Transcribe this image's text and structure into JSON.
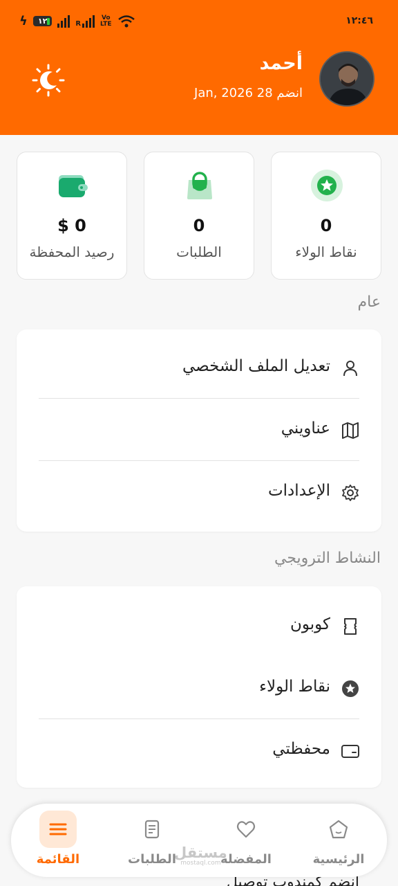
{
  "status_bar": {
    "time": "١٢:٤٦",
    "battery": "١٢",
    "network": "VoLTE"
  },
  "profile": {
    "name": "أحمد",
    "joined": "انضم 28 Jan, 2026"
  },
  "stats": [
    {
      "value": "0",
      "label": "نقاط الولاء",
      "icon": "star-badge-icon",
      "color": "#22b14c"
    },
    {
      "value": "0",
      "label": "الطلبات",
      "icon": "shopping-bag-icon",
      "color": "#22b14c"
    },
    {
      "value": "$ 0",
      "label": "رصيد المحفظة",
      "icon": "wallet-icon",
      "color": "#1aaa6e"
    }
  ],
  "sections": {
    "general": {
      "title": "عام",
      "items": [
        {
          "label": "تعديل الملف الشخصي",
          "icon": "user-icon"
        },
        {
          "label": "عناويني",
          "icon": "map-icon"
        },
        {
          "label": "الإعدادات",
          "icon": "gear-icon"
        }
      ]
    },
    "promo": {
      "title": "النشاط الترويجي",
      "items": [
        {
          "label": "كوبون",
          "icon": "coupon-icon"
        },
        {
          "label": "نقاط الولاء",
          "icon": "star-icon"
        },
        {
          "label": "محفظتي",
          "icon": "wallet-outline-icon"
        }
      ]
    },
    "partial_row": "انضم كمندوب توصيل"
  },
  "bottom_nav": [
    {
      "label": "الرئيسية",
      "icon": "home-icon",
      "active": false
    },
    {
      "label": "المفضلة",
      "icon": "heart-icon",
      "active": false
    },
    {
      "label": "الطلبات",
      "icon": "orders-icon",
      "active": false
    },
    {
      "label": "القائمة",
      "icon": "menu-icon",
      "active": true
    }
  ],
  "watermark": {
    "text": "مستقل",
    "sub": "mostaql.com"
  },
  "colors": {
    "brand": "#ff6a00",
    "accent_green": "#22b14c",
    "nav_active_bg": "#ffe8d6"
  }
}
